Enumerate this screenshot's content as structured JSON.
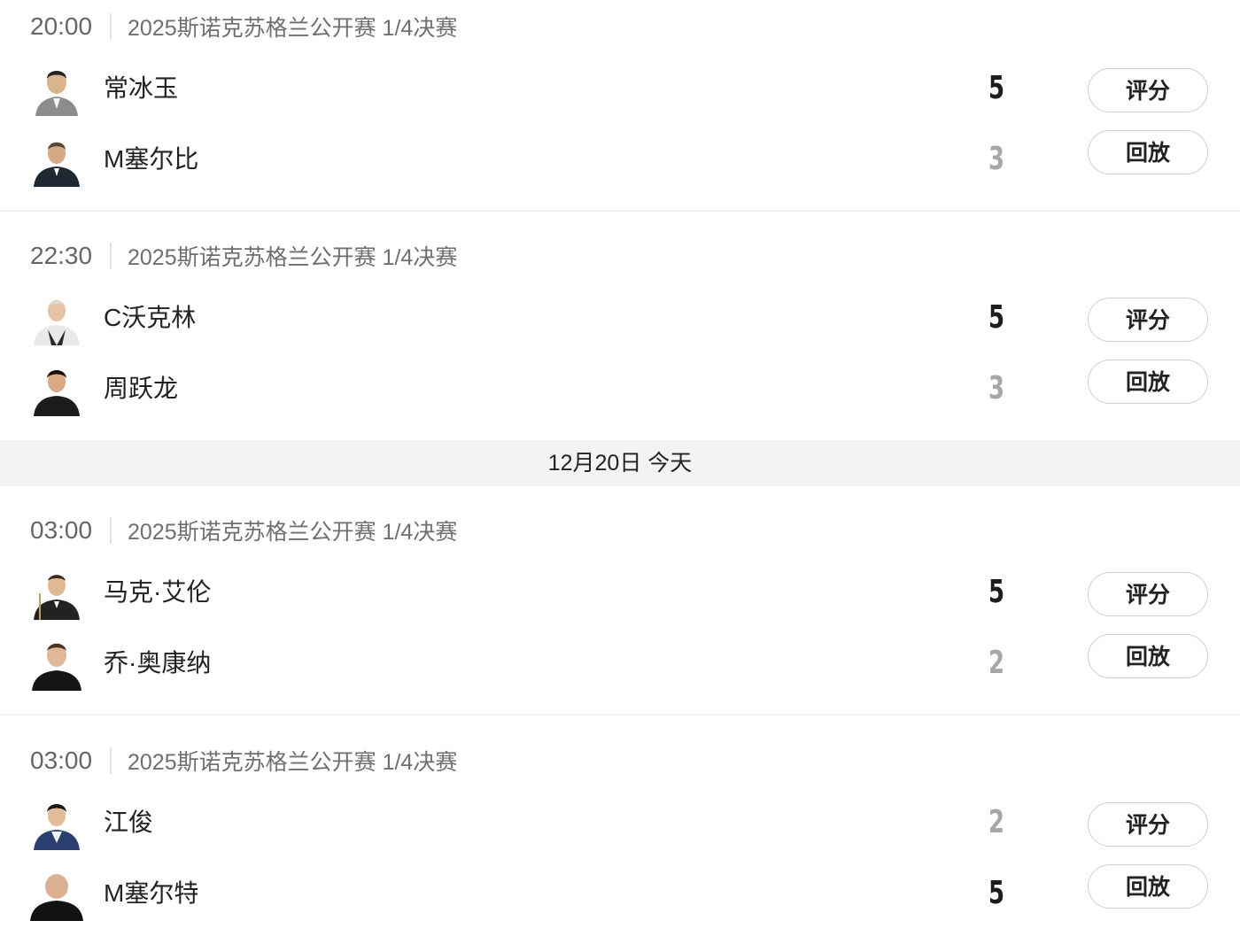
{
  "date_band": "12月20日 今天",
  "buttons": {
    "rate": "评分",
    "replay": "回放"
  },
  "matches": [
    {
      "time": "20:00",
      "title": "2025斯诺克苏格兰公开赛 1/4决赛",
      "players": [
        {
          "name": "常冰玉",
          "score": "5",
          "result": "win"
        },
        {
          "name": "M塞尔比",
          "score": "3",
          "result": "lose"
        }
      ]
    },
    {
      "time": "22:30",
      "title": "2025斯诺克苏格兰公开赛 1/4决赛",
      "players": [
        {
          "name": "C沃克林",
          "score": "5",
          "result": "win"
        },
        {
          "name": "周跃龙",
          "score": "3",
          "result": "lose"
        }
      ]
    },
    {
      "time": "03:00",
      "title": "2025斯诺克苏格兰公开赛 1/4决赛",
      "players": [
        {
          "name": "马克·艾伦",
          "score": "5",
          "result": "win"
        },
        {
          "name": "乔·奥康纳",
          "score": "2",
          "result": "lose"
        }
      ]
    },
    {
      "time": "03:00",
      "title": "2025斯诺克苏格兰公开赛 1/4决赛",
      "players": [
        {
          "name": "江俊",
          "score": "2",
          "result": "lose"
        },
        {
          "name": "M塞尔特",
          "score": "5",
          "result": "win"
        }
      ]
    }
  ]
}
